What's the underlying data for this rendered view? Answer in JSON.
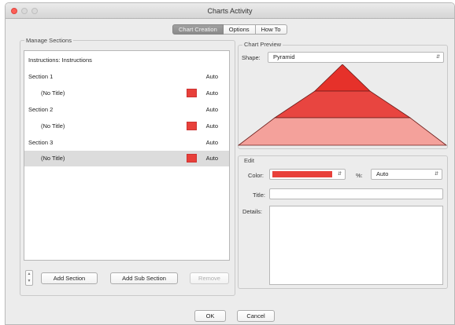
{
  "window": {
    "title": "Charts Activity"
  },
  "tabs": [
    {
      "label": "Chart Creation"
    },
    {
      "label": "Options"
    },
    {
      "label": "How To"
    }
  ],
  "manage": {
    "label": "Manage Sections",
    "rows": [
      {
        "text": "Instructions: Instructions",
        "auto": ""
      },
      {
        "text": "Section 1",
        "auto": "Auto"
      },
      {
        "text": "(No Title)",
        "auto": "Auto",
        "swatch": "#e8403a"
      },
      {
        "text": "Section 2",
        "auto": "Auto"
      },
      {
        "text": "(No Title)",
        "auto": "Auto",
        "swatch": "#e8403a"
      },
      {
        "text": "Section 3",
        "auto": "Auto"
      },
      {
        "text": "(No Title)",
        "auto": "Auto",
        "swatch": "#e8403a",
        "selected": true
      }
    ],
    "add_section": "Add Section",
    "add_sub_section": "Add Sub Section",
    "remove": "Remove"
  },
  "preview": {
    "label": "Chart Preview",
    "shape_label": "Shape:",
    "shape_value": "Pyramid",
    "colors": {
      "top": "#e6312a",
      "middle": "#e84540",
      "bottom": "#f4a19b"
    }
  },
  "edit": {
    "label": "Edit",
    "color_label": "Color:",
    "color_value": "#e8403a",
    "percent_label": "%:",
    "percent_value": "Auto",
    "title_label": "Title:",
    "title_value": "",
    "details_label": "Details:",
    "details_value": ""
  },
  "footer": {
    "ok": "OK",
    "cancel": "Cancel"
  }
}
